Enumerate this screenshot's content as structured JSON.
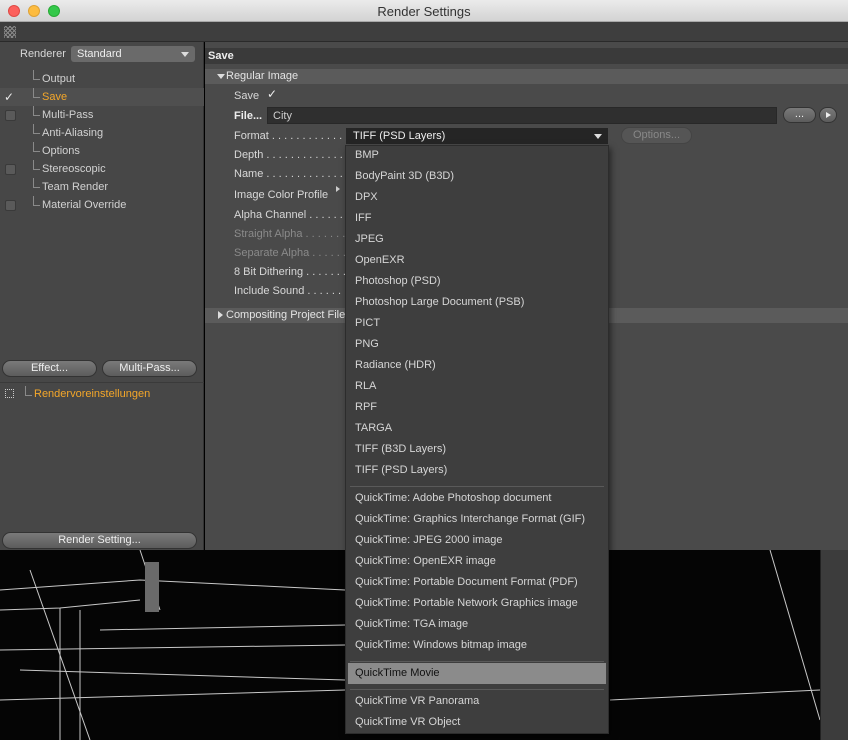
{
  "window": {
    "title": "Render Settings"
  },
  "left": {
    "renderer_label": "Renderer",
    "renderer_value": "Standard",
    "tree": [
      {
        "label": "Output",
        "checkbox": false,
        "checked": false,
        "active": false
      },
      {
        "label": "Save",
        "checkbox": false,
        "checked": true,
        "active": true
      },
      {
        "label": "Multi-Pass",
        "checkbox": true,
        "checked": false,
        "active": false
      },
      {
        "label": "Anti-Aliasing",
        "checkbox": false,
        "checked": false,
        "active": false
      },
      {
        "label": "Options",
        "checkbox": false,
        "checked": false,
        "active": false
      },
      {
        "label": "Stereoscopic",
        "checkbox": true,
        "checked": false,
        "active": false
      },
      {
        "label": "Team Render",
        "checkbox": false,
        "checked": false,
        "active": false
      },
      {
        "label": "Material Override",
        "checkbox": true,
        "checked": false,
        "active": false
      }
    ],
    "effect_button": "Effect...",
    "multipass_button": "Multi-Pass...",
    "preset_label": "Rendervoreinstellungen",
    "render_setting_button": "Render Setting..."
  },
  "right": {
    "header": "Save",
    "regular_image_section": "Regular Image",
    "compositing_section": "Compositing Project File",
    "save_label": "Save",
    "save_check": "✓",
    "file_label": "File...",
    "file_value": "City",
    "ellipsis_button": "...",
    "format_label": "Format",
    "format_value": "TIFF (PSD Layers)",
    "options_button": "Options...",
    "depth_label": "Depth",
    "name_label": "Name",
    "profile_label": "Image Color Profile",
    "alpha_label": "Alpha Channel",
    "straight_alpha_label": "Straight Alpha",
    "separate_alpha_label": "Separate Alpha",
    "dithering_label": "8 Bit Dithering",
    "include_sound_label": "Include Sound"
  },
  "dropdown": {
    "items": [
      "BMP",
      "BodyPaint 3D (B3D)",
      "DPX",
      "IFF",
      "JPEG",
      "OpenEXR",
      "Photoshop (PSD)",
      "Photoshop Large Document (PSB)",
      "PICT",
      "PNG",
      "Radiance (HDR)",
      "RLA",
      "RPF",
      "TARGA",
      "TIFF (B3D Layers)",
      "TIFF (PSD Layers)",
      "QuickTime: Adobe Photoshop document",
      "QuickTime: Graphics Interchange Format (GIF)",
      "QuickTime: JPEG 2000 image",
      "QuickTime: OpenEXR image",
      "QuickTime: Portable Document Format (PDF)",
      "QuickTime: Portable Network Graphics image",
      "QuickTime: TGA image",
      "QuickTime: Windows bitmap image",
      "QuickTime Movie",
      "QuickTime VR Panorama",
      "QuickTime VR Object"
    ],
    "selected": "QuickTime Movie"
  }
}
